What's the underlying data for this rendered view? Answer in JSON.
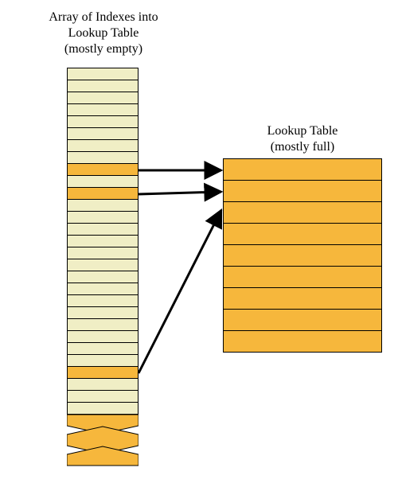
{
  "labels": {
    "index_array_title": "Array of Indexes into\nLookup Table\n(mostly empty)",
    "lookup_table_title": "Lookup Table\n(mostly full)"
  },
  "colors": {
    "empty_cell": "#f0eec5",
    "filled_cell": "#f6b73c",
    "border": "#000000",
    "arrow": "#000000"
  },
  "index_array": {
    "cells": [
      "empty",
      "empty",
      "empty",
      "empty",
      "empty",
      "empty",
      "empty",
      "empty",
      "full",
      "empty",
      "full",
      "empty",
      "empty",
      "empty",
      "empty",
      "empty",
      "empty",
      "empty",
      "empty",
      "empty",
      "empty",
      "empty",
      "empty",
      "empty",
      "empty",
      "full",
      "empty",
      "empty",
      "empty"
    ],
    "jagged_bottom": true
  },
  "lookup_table": {
    "rows": 9
  },
  "chart_data": {
    "type": "diagram",
    "title": "Index array to lookup table mapping",
    "index_array": {
      "label": "Array of Indexes into Lookup Table (mostly empty)",
      "total_cells_shown": 29,
      "filled_positions": [
        8,
        10,
        25
      ],
      "continues_below": true
    },
    "lookup_table": {
      "label": "Lookup Table (mostly full)",
      "rows_shown": 9
    },
    "mappings": [
      {
        "from_index_cell": 8,
        "to_lookup_row": 0
      },
      {
        "from_index_cell": 10,
        "to_lookup_row": 1
      },
      {
        "from_index_cell": 25,
        "to_lookup_row": 2
      }
    ]
  }
}
